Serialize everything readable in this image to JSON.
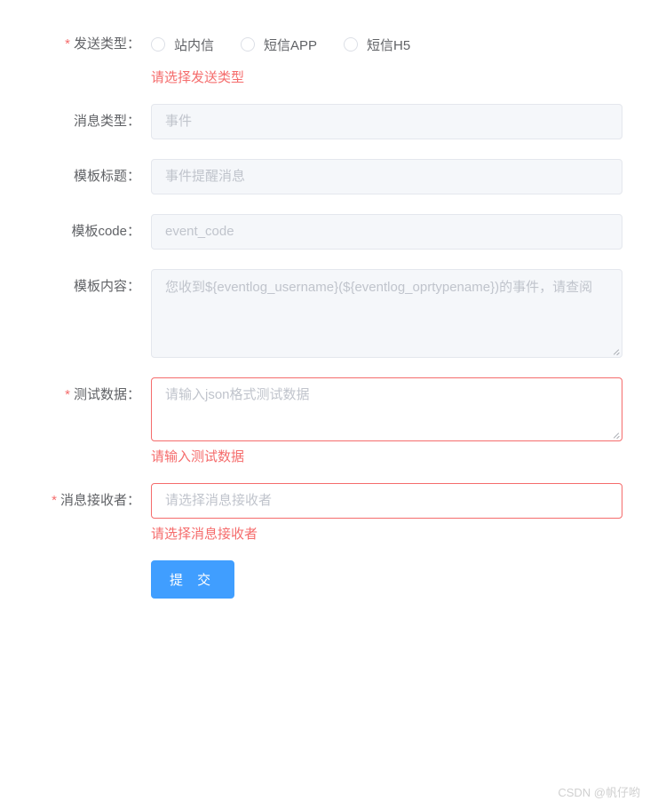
{
  "form": {
    "sendType": {
      "label": "发送类型：",
      "options": [
        {
          "label": "站内信"
        },
        {
          "label": "短信APP"
        },
        {
          "label": "短信H5"
        }
      ],
      "error": "请选择发送类型"
    },
    "msgType": {
      "label": "消息类型：",
      "value": "事件"
    },
    "templateTitle": {
      "label": "模板标题：",
      "value": "事件提醒消息"
    },
    "templateCode": {
      "label": "模板code：",
      "value": "event_code"
    },
    "templateContent": {
      "label": "模板内容：",
      "value": "您收到${eventlog_username}(${eventlog_oprtypename})的事件，请查阅"
    },
    "testData": {
      "label": "测试数据：",
      "placeholder": "请输入json格式测试数据",
      "error": "请输入测试数据"
    },
    "receiver": {
      "label": "消息接收者：",
      "placeholder": "请选择消息接收者",
      "error": "请选择消息接收者"
    },
    "submit": {
      "label": "提 交"
    }
  },
  "watermark": "CSDN @帆仔哟"
}
